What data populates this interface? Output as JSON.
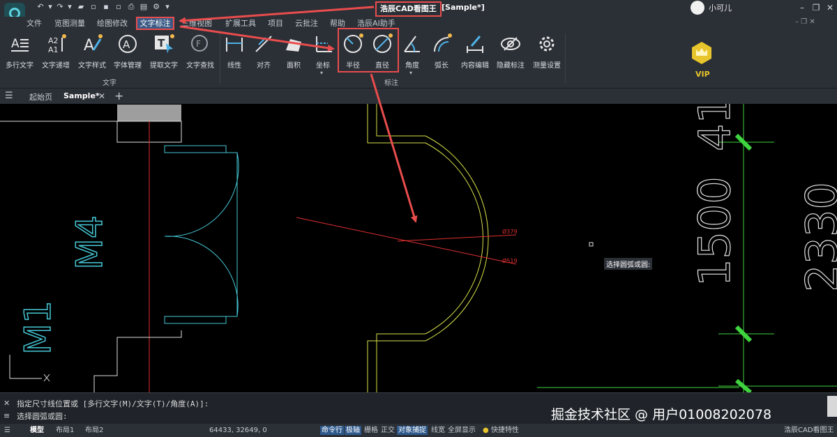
{
  "titlebar": {
    "app_title": "浩辰CAD看图王",
    "doc_title": "[Sample*]",
    "username": "小可儿",
    "quick_access": [
      "undo",
      "redo",
      "open",
      "save",
      "save-as",
      "print",
      "batch-print",
      "settings"
    ]
  },
  "menu": {
    "items": [
      "文件",
      "览图测量",
      "绘图修改",
      "文字标注",
      "三维视图",
      "扩展工具",
      "项目",
      "云批注",
      "帮助",
      "浩辰AI助手"
    ],
    "active": "文字标注"
  },
  "ribbon": {
    "text_group_label": "文字",
    "dim_group_label": "标注",
    "text_buttons": [
      "多行文字",
      "文字递增",
      "文字样式",
      "字体管理",
      "提取文字",
      "文字查找"
    ],
    "dim_buttons": [
      "线性",
      "对齐",
      "面积",
      "坐标",
      "半径",
      "直径",
      "角度",
      "弧长",
      "内容编辑",
      "隐藏标注",
      "测量设置"
    ],
    "vip_label": "VIP"
  },
  "tabs": {
    "home": "起始页",
    "sample": "Sample*",
    "add": "+"
  },
  "canvas": {
    "labels": {
      "m4": "M4",
      "m1": "M1",
      "dim_1500": "1500",
      "dim_41": "41",
      "dim_2330": "2330",
      "r_label1": "Ø379",
      "r_label2": "Ø519"
    },
    "cursor_tip": "选择圆弧或圆:",
    "colors": {
      "cyan": "#46c8d6",
      "green": "#3fd43f",
      "yellow": "#d8e24a",
      "red": "#e23030",
      "white": "#e0e0e0"
    }
  },
  "command": {
    "line1": "指定尺寸线位置或 [多行文字(M)/文字(T)/角度(A)]:",
    "line2": "选择圆弧或圆:"
  },
  "watermark": "掘金技术社区 @ 用户01008202078",
  "statusbar": {
    "model": "模型",
    "layout1": "布局1",
    "layout2": "布局2",
    "coords": "64433, 32649, 0",
    "toggles": [
      "命令行",
      "极轴",
      "栅格",
      "正交",
      "对象捕捉",
      "线宽",
      "全屏显示",
      "快捷特性"
    ],
    "active_toggles": [
      "命令行",
      "极轴",
      "对象捕捉"
    ],
    "app_name": "浩辰CAD看图王"
  }
}
